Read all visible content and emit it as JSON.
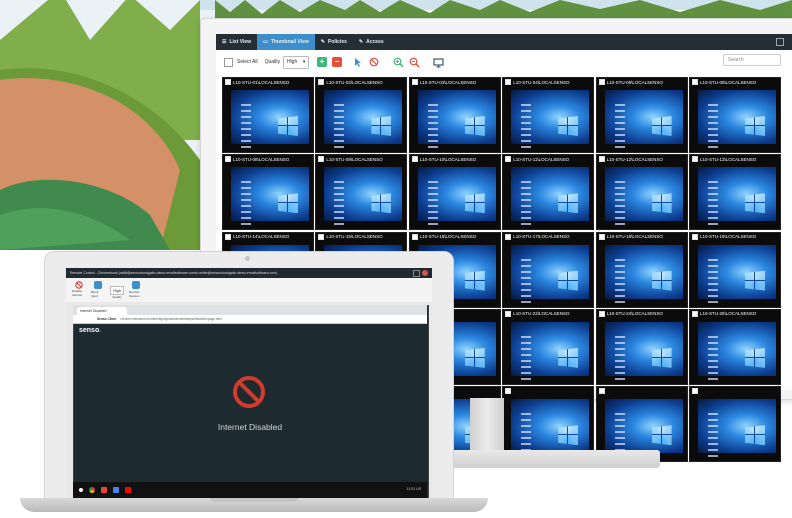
{
  "monitor": {
    "tabs": [
      {
        "label": "List View",
        "icon": "list-icon"
      },
      {
        "label": "Thumbnail View",
        "icon": "monitor-icon"
      },
      {
        "label": "Policies",
        "icon": "wrench-icon"
      },
      {
        "label": "Access",
        "icon": "wrench-icon"
      }
    ],
    "active_tab": "Thumbnail View",
    "toolbar": {
      "select_all_label": "Select All",
      "quality_label": "Quality",
      "quality_value": "High",
      "search_placeholder": "Search"
    },
    "thumbnails": [
      "L10-STU-01\\LOCALSENSO",
      "L10-STU-02\\LOCALSENSO",
      "L10-STU-03\\LOCALSENSO",
      "L10-STU-04\\LOCALSENSO",
      "L10-STU-05\\LOCALSENSO",
      "L10-STU-06\\LOCALSENSO",
      "L10-STU-08\\LOCALSENSO",
      "L10-STU-09\\LOCALSENSO",
      "L10-STU-10\\LOCALSENSO",
      "L10-STU-11\\LOCALSENSO",
      "L10-STU-12\\LOCALSENSO",
      "L10-STU-13\\LOCALSENSO",
      "L10-STU-14\\LOCALSENSO",
      "L10-STU-15\\LOCALSENSO",
      "L10-STU-16\\LOCALSENSO",
      "L10-STU-17\\LOCALSENSO",
      "L10-STU-18\\LOCALSENSO",
      "L10-STU-19\\LOCALSENSO",
      "",
      "",
      "",
      "L10-STU-22\\LOCALSENSO",
      "L10-STU-24\\LOCALSENSO",
      "L10-STU-25\\LOCALSENSO",
      "",
      "",
      "",
      "",
      "",
      ""
    ]
  },
  "laptop": {
    "window_title": "Remote Control - Chromebook (cstitt@sensocloudgatic.demo.emailsoftware.com\\u.white@sensocloudgatic.demo.emailsoftware.com)",
    "toolbar_items": [
      {
        "label": "Disable Internet",
        "icon": "no-entry-icon"
      },
      {
        "label": "Block Input",
        "icon": "list-icon"
      },
      {
        "label": "Quality",
        "value": "High"
      },
      {
        "label": "Remote Session",
        "icon": "monitor-icon"
      }
    ],
    "browser_tab": "Internet Disabled",
    "address_prefix": "Senso Client",
    "address_url": "chrome-extension://mhkhefbglolgkmlidolmhlnbekpicf/disabled/page.html",
    "brand": "senso",
    "brand_suffix": ".",
    "message": "Internet Disabled",
    "clock": "11:31 US"
  },
  "colors": {
    "nav_bg": "#252d35",
    "active_tab": "#3d8fc9",
    "add_green": "#3cb878",
    "remove_red": "#e74c3c",
    "no_entry_red": "#d33a2c",
    "senso_blue": "#41b6e6"
  }
}
